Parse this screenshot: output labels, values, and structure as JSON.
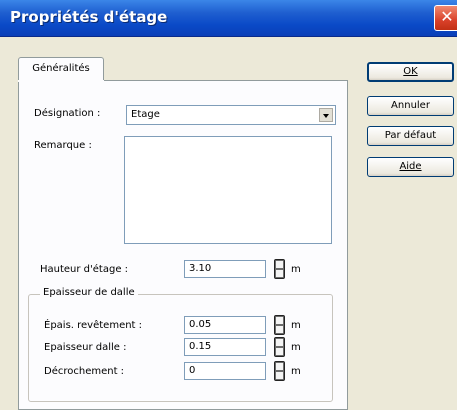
{
  "window": {
    "title": "Propriétés d'étage",
    "close_glyph": "✕"
  },
  "tabs": [
    {
      "label": "Généralités"
    }
  ],
  "designation": {
    "label": "Désignation :",
    "value": "Etage"
  },
  "remarque": {
    "label": "Remarque :",
    "value": ""
  },
  "hauteur": {
    "label": "Hauteur d'étage :",
    "value": "3.10",
    "unit": "m"
  },
  "epaisseur_group": {
    "title": "Epaisseur de dalle",
    "rows": [
      {
        "label": "Épais. revêtement :",
        "value": "0.05",
        "unit": "m"
      },
      {
        "label": "Epaisseur dalle :",
        "value": "0.15",
        "unit": "m"
      },
      {
        "label": "Décrochement :",
        "value": "0",
        "unit": "m"
      }
    ]
  },
  "buttons": {
    "ok": "OK",
    "annuler": "Annuler",
    "par_defaut": "Par défaut",
    "aide": "Aide"
  },
  "colors": {
    "titlebar": "#0a49c7",
    "close": "#d9412a",
    "dialog_bg": "#ece9d8",
    "panel_bg": "#fcfcfe"
  },
  "icons": {
    "close": "close-icon",
    "dropdown": "chevron-down-icon",
    "spinner": "spinner-icon"
  }
}
